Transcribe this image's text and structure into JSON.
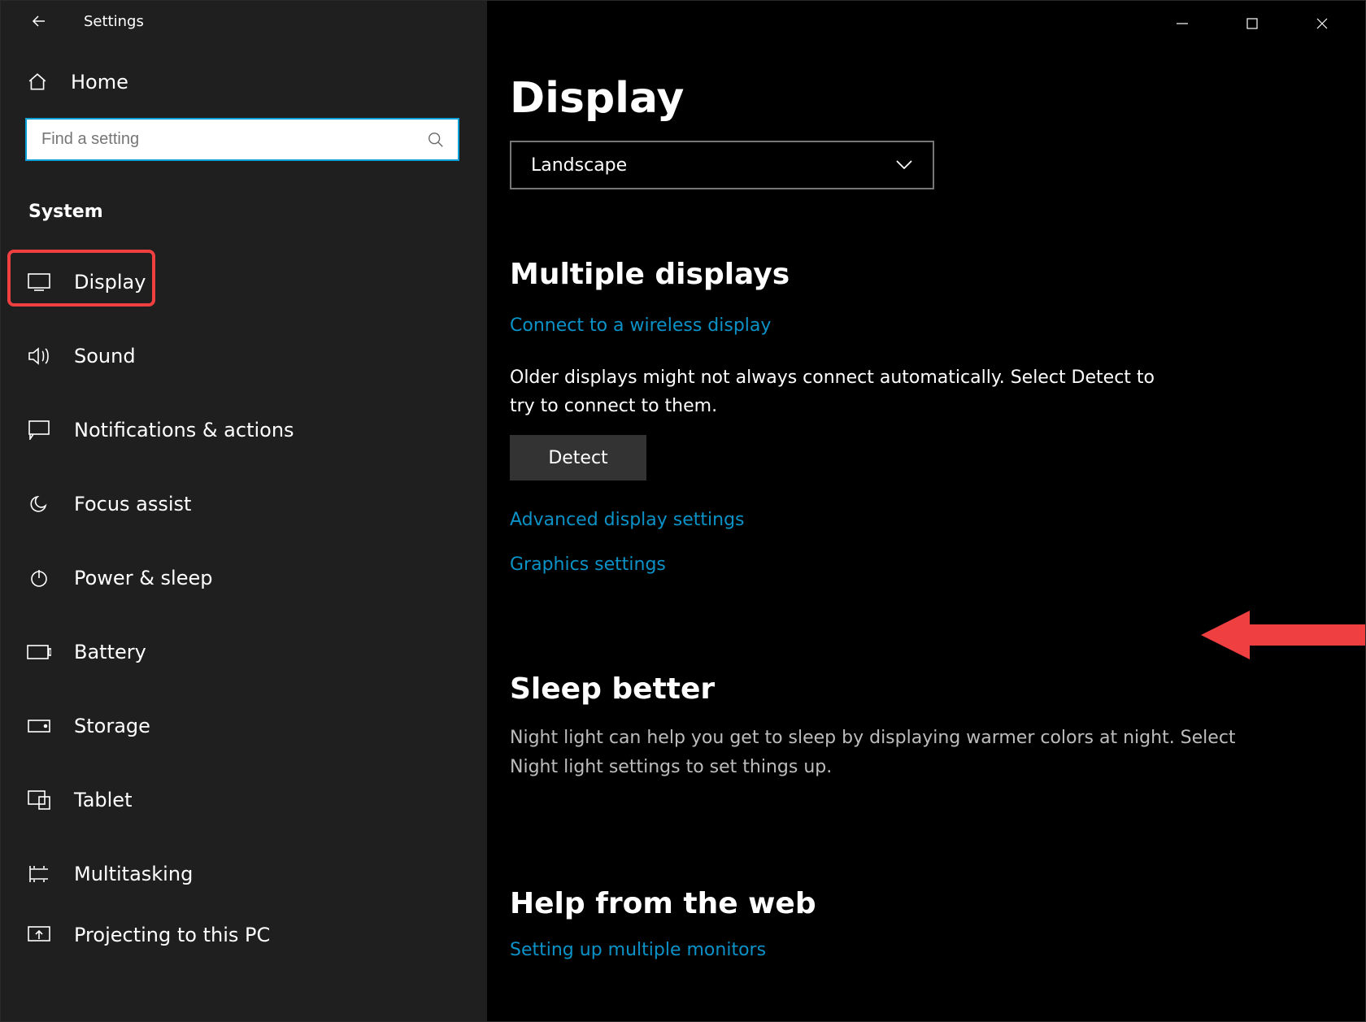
{
  "app": {
    "title": "Settings"
  },
  "sidebar": {
    "home": "Home",
    "search_placeholder": "Find a setting",
    "section": "System",
    "items": [
      {
        "label": "Display"
      },
      {
        "label": "Sound"
      },
      {
        "label": "Notifications & actions"
      },
      {
        "label": "Focus assist"
      },
      {
        "label": "Power & sleep"
      },
      {
        "label": "Battery"
      },
      {
        "label": "Storage"
      },
      {
        "label": "Tablet"
      },
      {
        "label": "Multitasking"
      },
      {
        "label": "Projecting to this PC"
      }
    ]
  },
  "main": {
    "title": "Display",
    "orientation_value": "Landscape",
    "sections": {
      "multi": {
        "heading": "Multiple displays",
        "link_wireless": "Connect to a wireless display",
        "older_text": "Older displays might not always connect automatically. Select Detect to try to connect to them.",
        "detect_btn": "Detect",
        "link_advanced": "Advanced display settings",
        "link_graphics": "Graphics settings"
      },
      "sleep": {
        "heading": "Sleep better",
        "text": "Night light can help you get to sleep by displaying warmer colors at night. Select Night light settings to set things up."
      },
      "help": {
        "heading": "Help from the web",
        "link_multimon": "Setting up multiple monitors"
      }
    }
  }
}
